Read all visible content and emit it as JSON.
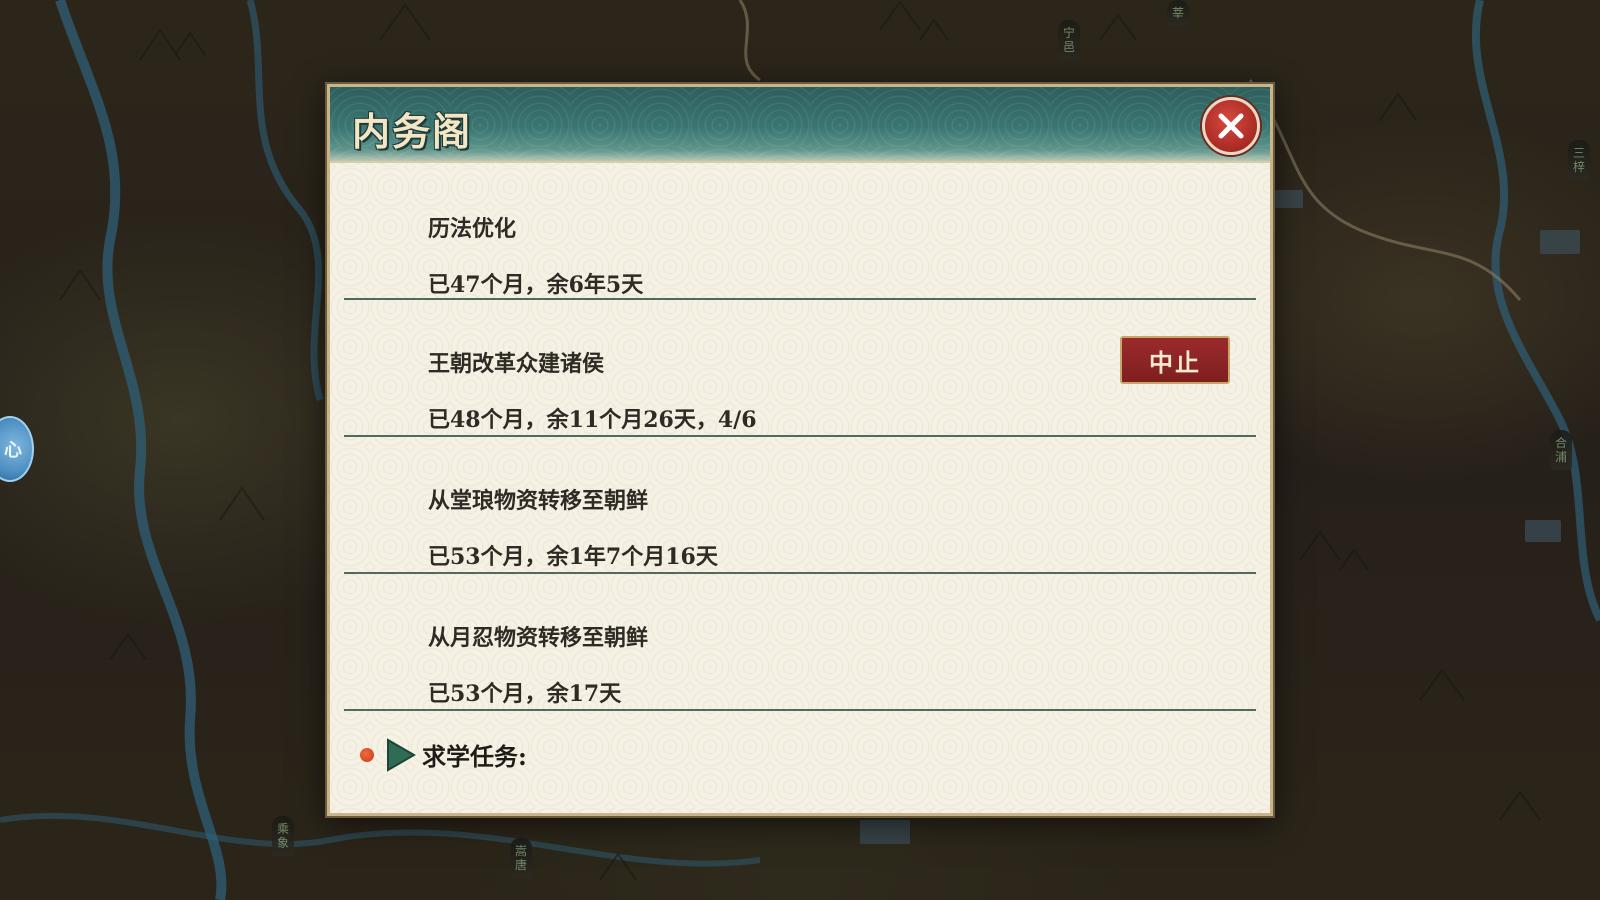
{
  "dialog": {
    "title": "内务阁",
    "close_icon": "close-icon",
    "tasks": [
      {
        "title": "历法优化",
        "progress": "已47个月，余6年5天"
      },
      {
        "title": "王朝改革众建诸侯",
        "progress": "已48个月，余11个月26天，4/6",
        "action_label": "中止"
      },
      {
        "title": "从堂琅物资转移至朝鲜",
        "progress": "已53个月，余1年7个月16天"
      },
      {
        "title": "从月忍物资转移至朝鲜",
        "progress": "已53个月，余17天"
      }
    ],
    "study_label": "求学任务:"
  },
  "map": {
    "markers": [
      "宁邑",
      "莘",
      "三梓",
      "合浦",
      "嵩唐",
      "乘象"
    ],
    "side_orb_label": "心"
  },
  "colors": {
    "header_teal": "#3b7672",
    "panel_bg": "#f6f1e5",
    "button_red": "#8a2323",
    "close_red": "#b02e27",
    "divider": "#4d6b5f"
  }
}
